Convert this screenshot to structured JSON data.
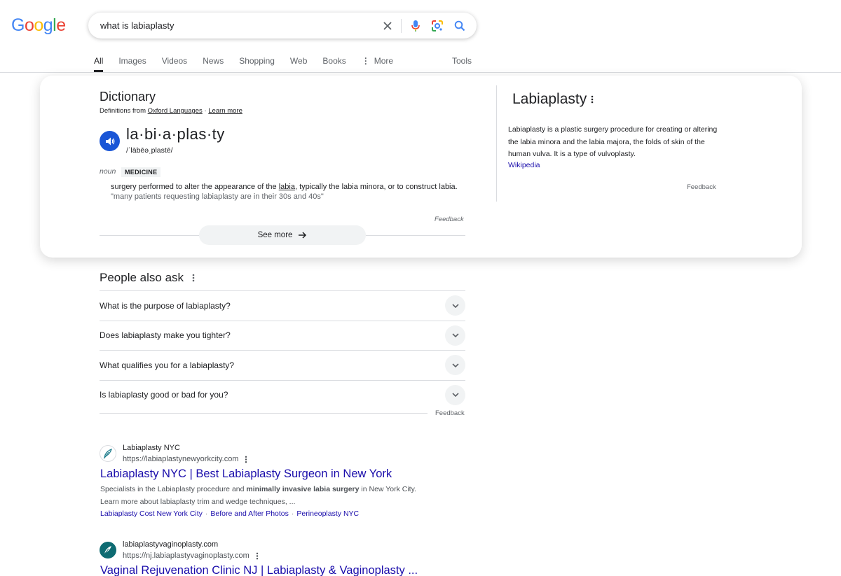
{
  "logo": {
    "letters": [
      "G",
      "o",
      "o",
      "g",
      "l",
      "e"
    ],
    "colors": [
      "#4285F4",
      "#EA4335",
      "#FBBC05",
      "#4285F4",
      "#34A853",
      "#EA4335"
    ]
  },
  "search": {
    "query": "what is labiaplasty"
  },
  "tabs": [
    {
      "label": "All",
      "active": true
    },
    {
      "label": "Images"
    },
    {
      "label": "Videos"
    },
    {
      "label": "News"
    },
    {
      "label": "Shopping"
    },
    {
      "label": "Web"
    },
    {
      "label": "Books"
    },
    {
      "label": "More"
    }
  ],
  "tools_label": "Tools",
  "dictionary": {
    "title": "Dictionary",
    "source_prefix": "Definitions from",
    "source_name": "Oxford Languages",
    "source_sep": "·",
    "learn_more": "Learn more",
    "headword": "la·bi·a·plas·ty",
    "phonetic": "/ˈlābēəˌplastē/",
    "pos": "noun",
    "domain": "MEDICINE",
    "def_before": "surgery performed to alter the appearance of the",
    "def_link": "labia",
    "def_after": ", typically the labia minora, or to construct labia.",
    "example": "\"many patients requesting labiaplasty are in their 30s and 40s\"",
    "feedback": "Feedback",
    "see_more": "See more"
  },
  "knowledge_panel": {
    "title": "Labiaplasty",
    "description": "Labiaplasty is a plastic surgery procedure for creating or altering the labia minora and the labia majora, the folds of skin of the human vulva. It is a type of vulvoplasty.",
    "source": "Wikipedia",
    "feedback": "Feedback"
  },
  "paa": {
    "title": "People also ask",
    "questions": [
      "What is the purpose of labiaplasty?",
      "Does labiaplasty make you tighter?",
      "What qualifies you for a labiaplasty?",
      "Is labiaplasty good or bad for you?"
    ],
    "feedback": "Feedback"
  },
  "results": [
    {
      "site": "Labiaplasty NYC",
      "url": "https://labiaplastynewyorkcity.com",
      "title": "Labiaplasty NYC | Best Labiaplasty Surgeon in New York",
      "snippet_1": "Specialists in the Labiaplasty procedure and ",
      "snippet_bold": "minimally invasive labia surgery",
      "snippet_2": " in New York City. Learn more about labiaplasty trim and wedge techniques, ...",
      "sitelinks": [
        "Labiaplasty Cost New York City",
        "Before and After Photos",
        "Perineoplasty NYC"
      ]
    },
    {
      "site": "labiaplastyvaginoplasty.com",
      "url": "https://nj.labiaplastyvaginoplasty.com",
      "title": "Vaginal Rejuvenation Clinic NJ | Labiaplasty & Vaginoplasty ..."
    }
  ]
}
